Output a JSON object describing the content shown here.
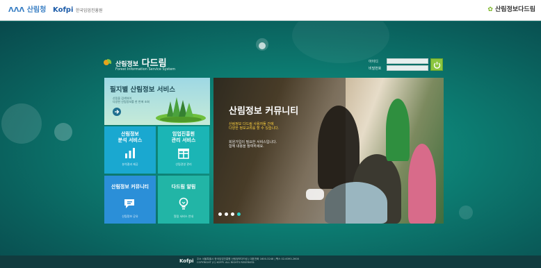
{
  "header": {
    "left_logos": [
      {
        "name": "ministry-logo",
        "text": "ΛΛΛ 산림청",
        "sub": ""
      },
      {
        "name": "kofpi-logo",
        "text": "Kofpi",
        "sub": "한국임업진흥원"
      }
    ],
    "right_logo_text": "산림정보다드림"
  },
  "brand": {
    "title_kr": "산림정보",
    "title_emph": "다드림",
    "subtitle": "Forest Information Service System"
  },
  "login": {
    "id_label": "아이디",
    "pw_label": "비밀번호",
    "id_value": "",
    "pw_value": "",
    "button_label": "로그인"
  },
  "tiles": {
    "main": {
      "title": "필지별 산림정보 서비스",
      "desc_line1": "산림을 검색하여",
      "desc_line2": "다양한 산림정보를 한 번에 조회"
    },
    "analysis": {
      "title_line1": "산림정보",
      "title_line2": "분석 서비스",
      "desc": "분석결과 제공"
    },
    "consult": {
      "title_line1": "임업진흥원",
      "title_line2": "관리 서비스",
      "desc": "산림경영 관리"
    },
    "community": {
      "title": "산림정보 커뮤니티",
      "desc": "산림정보 공유"
    },
    "alarm": {
      "title": "다드림 알림",
      "desc": "알림 서비스 안내"
    }
  },
  "feature": {
    "title": "산림정보 커뮤니티",
    "lead_line1": "산림정보 다드림 사용자들 간에",
    "lead_line2": "다양한 정보교류를 할 수 있습니다.",
    "body_line1": "회원가입이 필요한 서비스입니다.",
    "body_line2": "함께 내용을 참여하세요.",
    "slide_count": 4,
    "active_slide": 4
  },
  "footer": {
    "logo": "Kofpi",
    "line1": "주소 서울특별시 한국임업진흥원 산림정보다드림 | 대표전화 1600-3248 | 팩스 02-6393-2600",
    "line2": "COPYRIGHT (C) KOFPI. ALL RIGHTS RESERVED."
  },
  "colors": {
    "bg_teal": "#0d8276",
    "tile_blue": "#1aa8d0",
    "tile_teal": "#1bb5b5",
    "tile_darkblue": "#2b8fd8",
    "login_green": "#8cc63f",
    "accent_yellow": "#ffd23f"
  }
}
